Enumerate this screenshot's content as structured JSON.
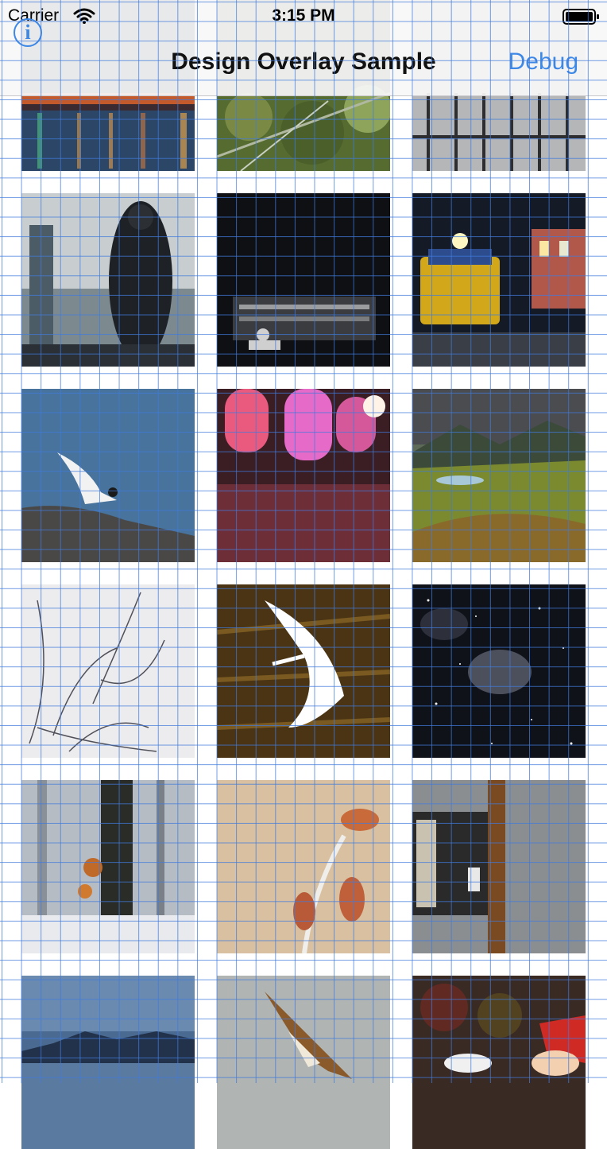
{
  "status_bar": {
    "carrier": "Carrier",
    "time": "3:15 PM"
  },
  "nav": {
    "title": "Design Overlay Sample",
    "debug_label": "Debug",
    "info_label": "i"
  },
  "photos": [
    {
      "name": "harbor-lights-photo"
    },
    {
      "name": "tree-branches-photo"
    },
    {
      "name": "iron-gate-photo"
    },
    {
      "name": "rainy-window-people-photo"
    },
    {
      "name": "dark-studio-man-photo"
    },
    {
      "name": "train-night-photo"
    },
    {
      "name": "tern-on-rocks-photo"
    },
    {
      "name": "pink-bokeh-lights-photo"
    },
    {
      "name": "green-valley-mountains-photo"
    },
    {
      "name": "winter-grass-photo"
    },
    {
      "name": "egret-flying-photo"
    },
    {
      "name": "night-sky-nebula-photo"
    },
    {
      "name": "foggy-forest-photo"
    },
    {
      "name": "frosted-leaves-photo"
    },
    {
      "name": "wooden-window-wall-photo"
    },
    {
      "name": "blue-lake-mountains-photo"
    },
    {
      "name": "bird-of-prey-photo"
    },
    {
      "name": "garden-gnome-photo"
    }
  ]
}
